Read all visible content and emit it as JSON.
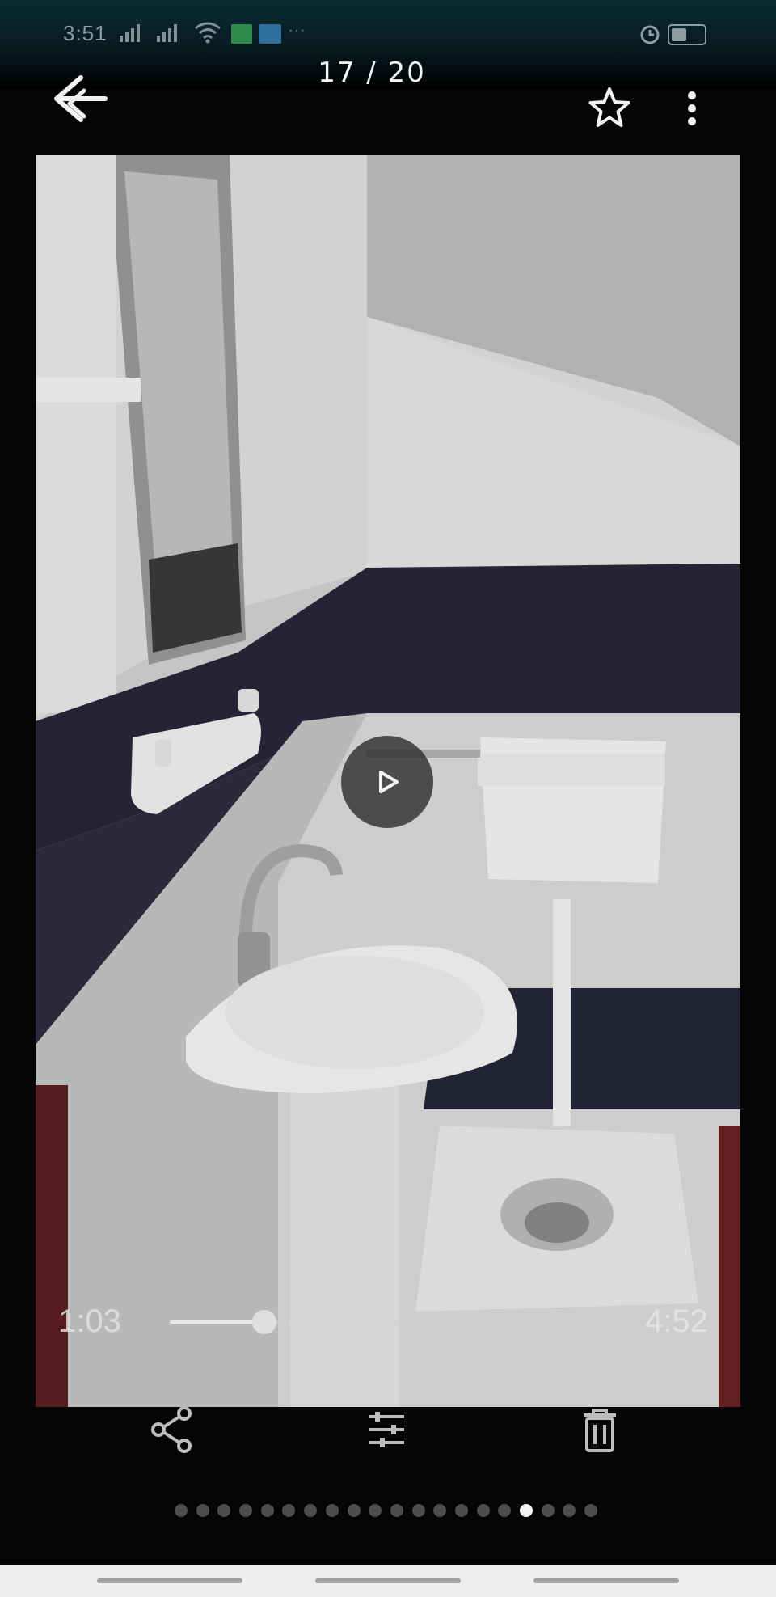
{
  "status_bar": {
    "time": "3:51"
  },
  "app_bar": {
    "counter": "17 / 20"
  },
  "player": {
    "elapsed": "1:03",
    "total": "4:52",
    "progress": 0.216
  },
  "pager": {
    "total": 20,
    "active_index": 16
  },
  "icons": [
    "back-arrow-icon",
    "star-icon",
    "more-vert-icon",
    "play-icon",
    "share-icon",
    "edit-sliders-icon",
    "delete-icon"
  ]
}
